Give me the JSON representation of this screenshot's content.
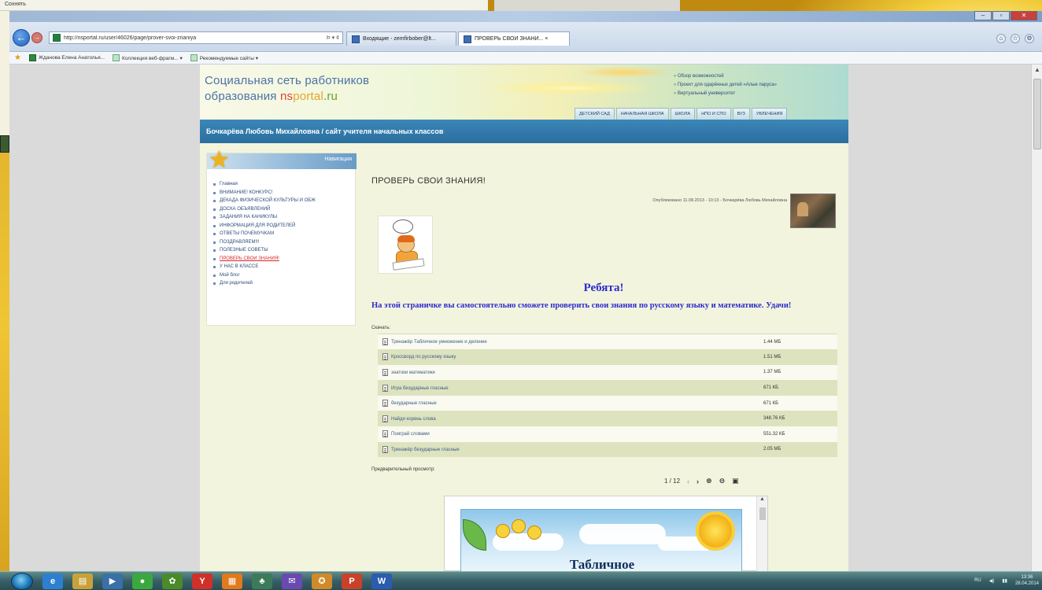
{
  "desktop": {
    "top_window_title": "Сохнять"
  },
  "browser": {
    "address_url": "http://nsportal.ru/user/46026/page/prover-svoi-znaniya",
    "address_actions": "Ϸ ▾ ¢",
    "tabs": [
      {
        "label": "Входящие - zemfirbober@lt..."
      },
      {
        "label": "ПРОВЕРЬ СВОИ ЗНАНИ... ×"
      }
    ],
    "favorites": [
      {
        "label": "Жданова Елена Анатолья..."
      },
      {
        "label": "Коллекция веб-фрагм... ▾"
      },
      {
        "label": "Рекомендуемые сайты ▾"
      }
    ]
  },
  "site": {
    "title_line1": "Социальная сеть работников",
    "title_line2_prefix": "образования ",
    "logo_ns": "ns",
    "logo_portal": "portal",
    "logo_ru": ".ru",
    "header_links": [
      "Обзор возможностей",
      "Проект для одарённых детей «Алые паруса»",
      "Виртуальный университет"
    ],
    "header_tabs": [
      "ДЕТСКИЙ САД",
      "НАЧАЛЬНАЯ ШКОЛА",
      "ШКОЛА",
      "НПО И СПО",
      "ВУЗ",
      "УВЛЕЧЕНИЯ"
    ],
    "owner_title": "Бочкарёва Любовь Михайловна / сайт учителя начальных классов"
  },
  "nav": {
    "header_label": "Навигация",
    "items": [
      {
        "label": "Главная",
        "active": false
      },
      {
        "label": "ВНИМАНИЕ! КОНКУРС!",
        "active": false
      },
      {
        "label": "ДЕКАДА ФИЗИЧЕСКОЙ КУЛЬТУРЫ И ОБЖ",
        "active": false
      },
      {
        "label": "ДОСКА ОБЪЯВЛЕНИЙ",
        "active": false
      },
      {
        "label": "ЗАДАНИЯ НА КАНИКУЛЫ",
        "active": false
      },
      {
        "label": "ИНФОРМАЦИЯ ДЛЯ РОДИТЕЛЕЙ",
        "active": false
      },
      {
        "label": "ОТВЕТЫ ПОЧЕМУЧКАМ",
        "active": false
      },
      {
        "label": "ПОЗДРАВЛЯЕМ!!!",
        "active": false
      },
      {
        "label": "ПОЛЕЗНЫЕ СОВЕТЫ",
        "active": false
      },
      {
        "label": "ПРОВЕРЬ СВОИ ЗНАНИЯ!",
        "active": true
      },
      {
        "label": "У НАС В КЛАССЕ",
        "active": false
      },
      {
        "label": "Мой блог",
        "active": false
      },
      {
        "label": "Для родителей",
        "active": false
      }
    ]
  },
  "article": {
    "title": "ПРОВЕРЬ СВОИ ЗНАНИЯ!",
    "meta": "Опубликовано 11.08.2013 - 10:13 - Бочкарёва Любовь Михайловна",
    "greeting": "Ребята!",
    "intro": "На этой страничке вы самостоятельно сможете проверить свои знания по русскому языку и математике. Удачи!",
    "downloads_label": "Скачать:",
    "preview_label": "Предварительный просмотр:"
  },
  "downloads": [
    {
      "name": "Тренажёр Табличное умножение и деление",
      "size": "1.44 МБ"
    },
    {
      "name": "Кроссворд по русскому языку",
      "size": "1.51 МБ"
    },
    {
      "name": "знатоки математики",
      "size": "1.37 МБ"
    },
    {
      "name": "Игра безударные гласные",
      "size": "671 КБ"
    },
    {
      "name": "безударные гласные",
      "size": "671 КБ"
    },
    {
      "name": "Найди корень слова",
      "size": "348.76 КБ"
    },
    {
      "name": "Поиграй словами",
      "size": "551.32 КБ"
    },
    {
      "name": "Тренажёр безударные гласные",
      "size": "2.05 МБ"
    }
  ],
  "viewer": {
    "page_indicator": "1 / 12",
    "prev_label": "‹",
    "next_label": "›",
    "slide_title": "Табличное"
  },
  "taskbar": {
    "apps": [
      {
        "glyph": "e",
        "color": "#2f7fd0"
      },
      {
        "glyph": "▤",
        "color": "#c9a13a"
      },
      {
        "glyph": "▶",
        "color": "#3a6fa8"
      },
      {
        "glyph": "●",
        "color": "#3aa83e"
      },
      {
        "glyph": "✿",
        "color": "#4a8a2a"
      },
      {
        "glyph": "Y",
        "color": "#d0302a"
      },
      {
        "glyph": "▦",
        "color": "#e07a1a"
      },
      {
        "glyph": "♣",
        "color": "#3d7a5a"
      },
      {
        "glyph": "✉",
        "color": "#6a4ab0"
      },
      {
        "glyph": "✪",
        "color": "#d08a2a"
      },
      {
        "glyph": "P",
        "color": "#c8422a"
      },
      {
        "glyph": "W",
        "color": "#2a5cb0"
      }
    ],
    "tray_lang": "RU",
    "tray_time": "13:36",
    "tray_date": "28.04.2014"
  }
}
